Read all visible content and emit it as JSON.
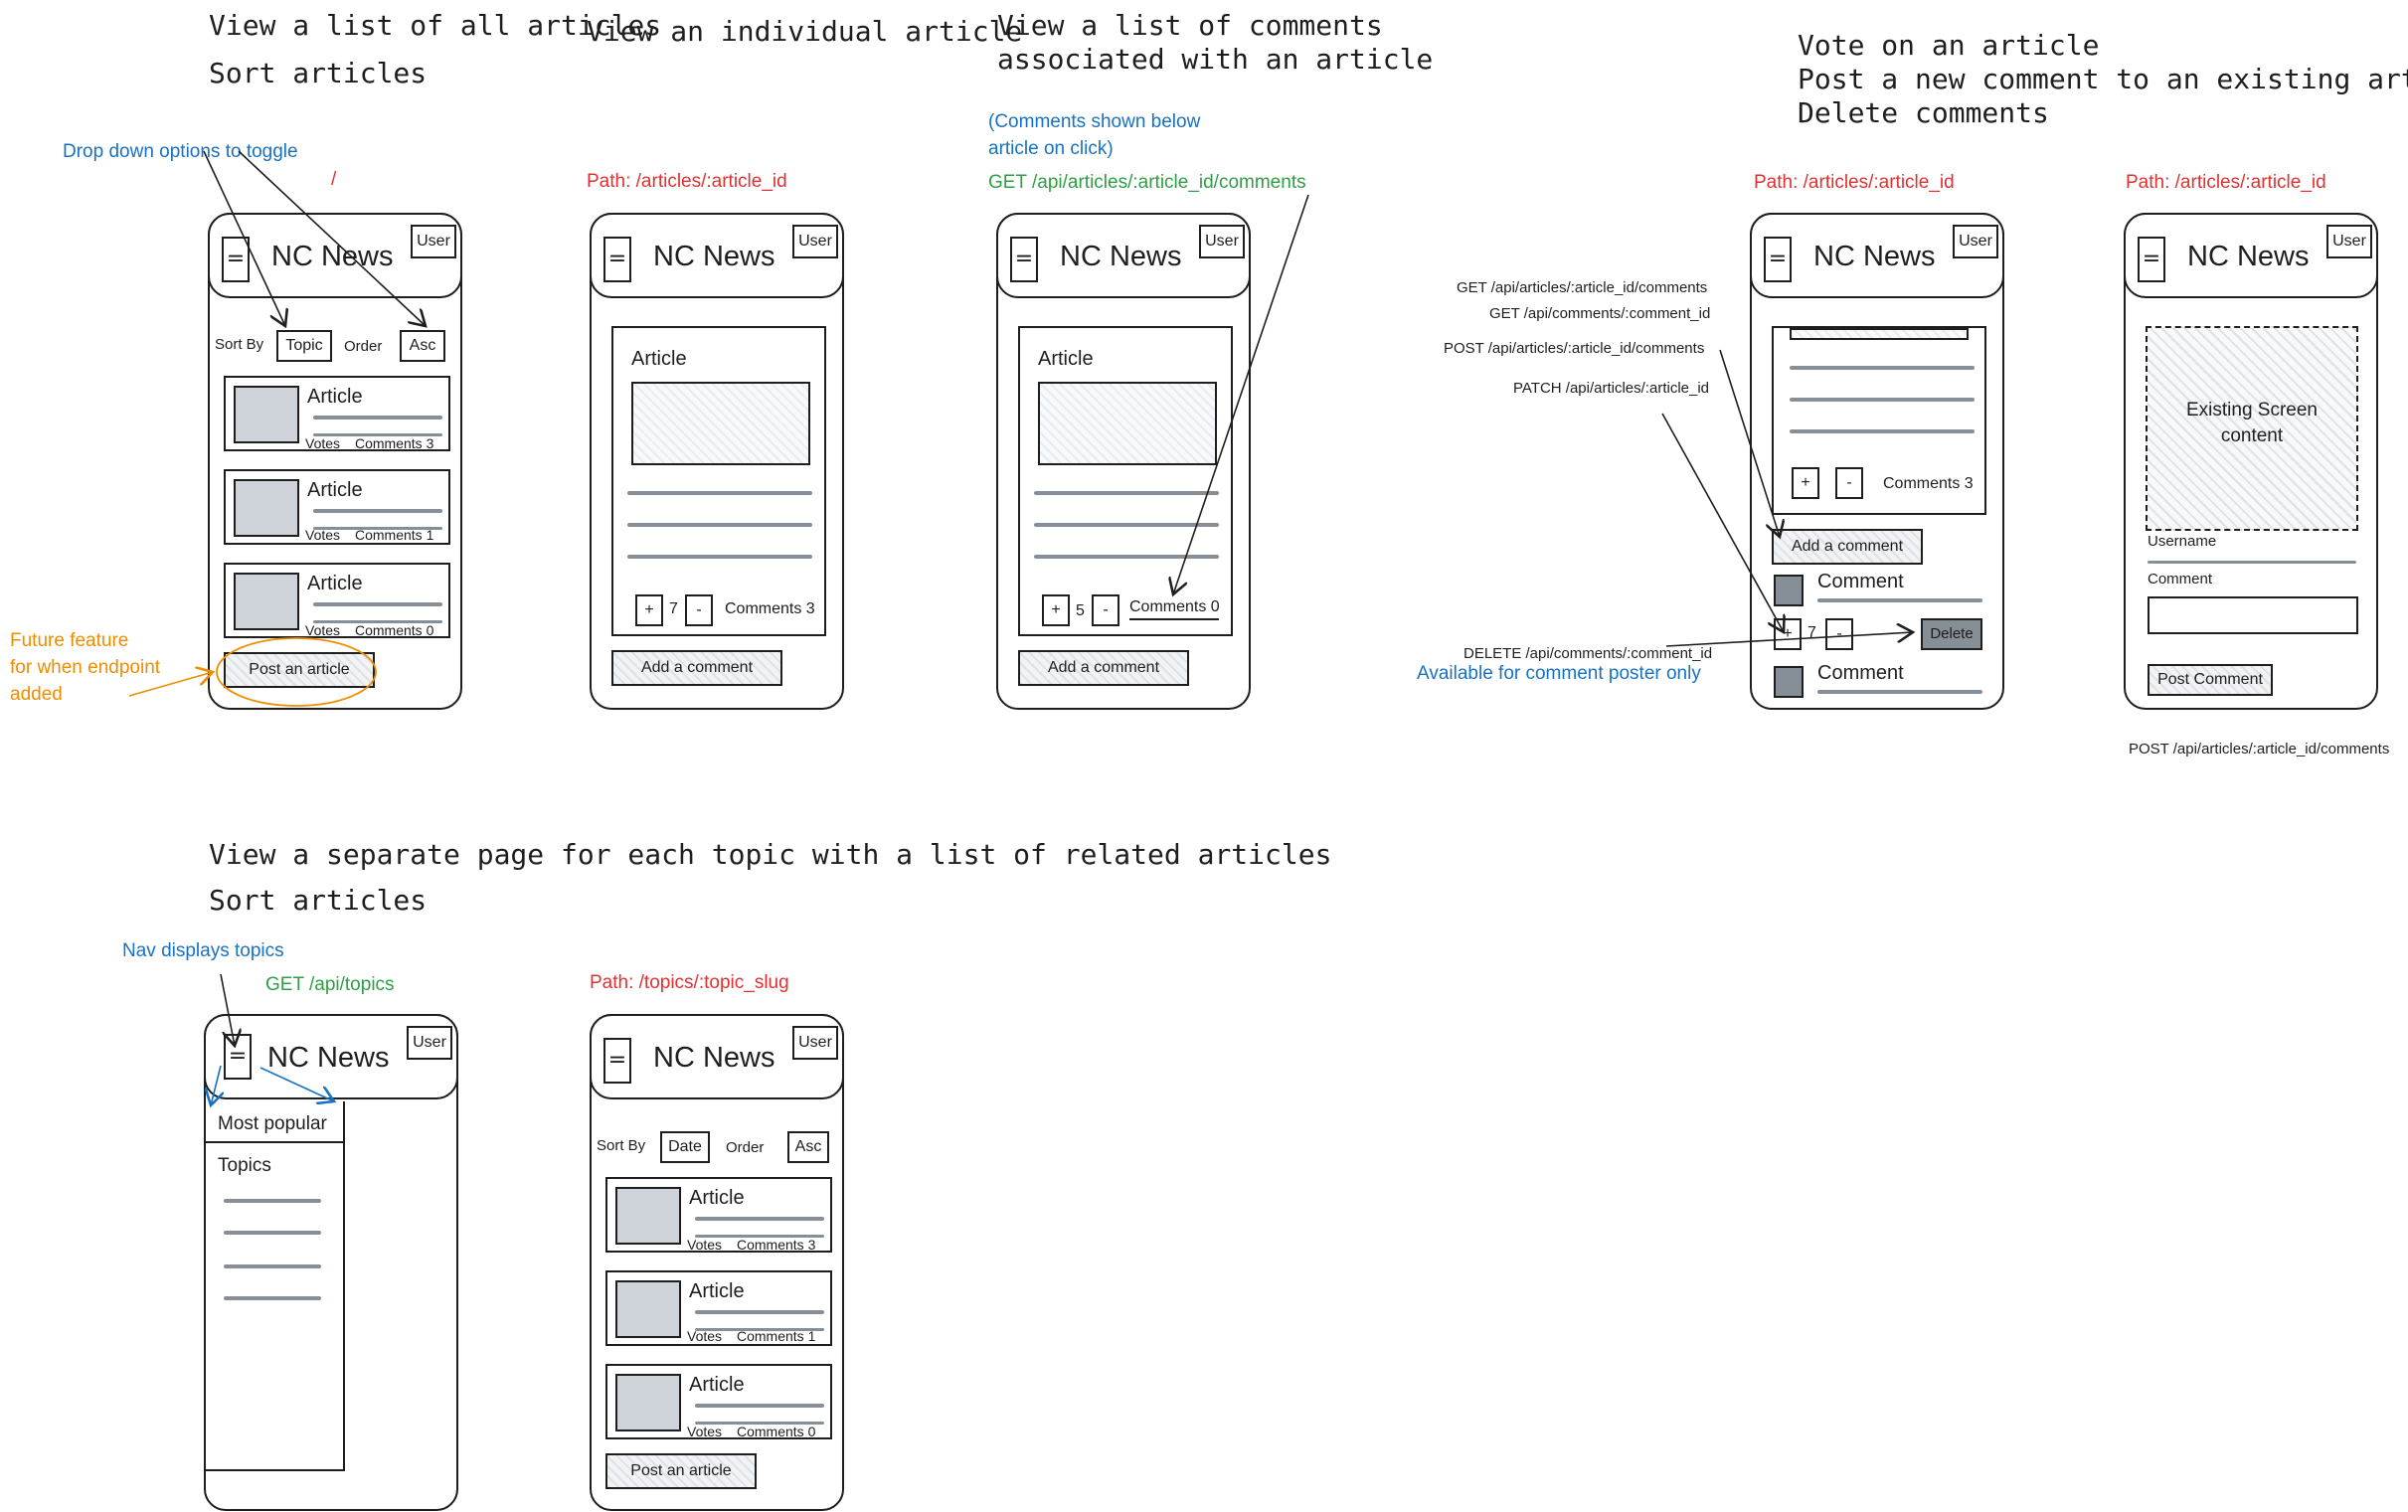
{
  "headings": {
    "h1_line1": "View a list of all articles",
    "h1_line2": "Sort articles",
    "h2": "View an individual article",
    "h3_line1": "View a list of comments",
    "h3_line2": "associated with an article",
    "h4_line1": "Vote on an article",
    "h4_line2": "Post a new comment to an existing article",
    "h4_line3": "Delete comments",
    "h5_line1": "View a separate page for each topic with a list of related articles",
    "h5_line2": "Sort articles"
  },
  "notes": {
    "dropdown": "Drop down options to toggle",
    "slash": "/",
    "future_line1": "Future feature",
    "future_line2": "for when endpoint",
    "future_line3": "added",
    "path_article": "Path: /articles/:article_id",
    "comments_shown_line1": "(Comments shown below",
    "comments_shown_line2": "article on click)",
    "get_comments": "GET /api/articles/:article_id/comments",
    "path_article_4": "Path: /articles/:article_id",
    "path_article_5": "Path: /articles/:article_id",
    "api_get_comments": "GET /api/articles/:article_id/comments",
    "api_get_comment": "GET /api/comments/:comment_id",
    "api_post_comments": "POST /api/articles/:article_id/comments",
    "api_patch_article": "PATCH /api/articles/:article_id",
    "api_delete_comment": "DELETE /api/comments/:comment_id",
    "available_poster": "Available for comment poster only",
    "api_post_comments_2": "POST /api/articles/:article_id/comments",
    "nav_topics": "Nav displays topics",
    "get_topics": "GET /api/topics",
    "path_topics": "Path: /topics/:topic_slug"
  },
  "app": {
    "title": "NC News",
    "user": "User",
    "menu": "=",
    "sort_by": "Sort By",
    "order": "Order",
    "topic": "Topic",
    "date": "Date",
    "asc": "Asc",
    "article": "Article",
    "votes": "Votes",
    "comments_3": "Comments 3",
    "comments_1": "Comments 1",
    "comments_0": "Comments 0",
    "post_article": "Post an article",
    "add_comment": "Add a comment",
    "plus": "+",
    "minus": "-",
    "votes_7": "7",
    "votes_5": "5",
    "comment": "Comment",
    "delete": "Delete",
    "existing_line1": "Existing Screen",
    "existing_line2": "content",
    "username": "Username",
    "post_comment": "Post Comment",
    "most_popular": "Most popular",
    "topics": "Topics"
  },
  "colors": {
    "blue": "#1971c2",
    "green": "#2f9e44",
    "red": "#e03131",
    "orange": "#f08c00",
    "ink": "#1e1e1e",
    "grey": "#868e96"
  }
}
